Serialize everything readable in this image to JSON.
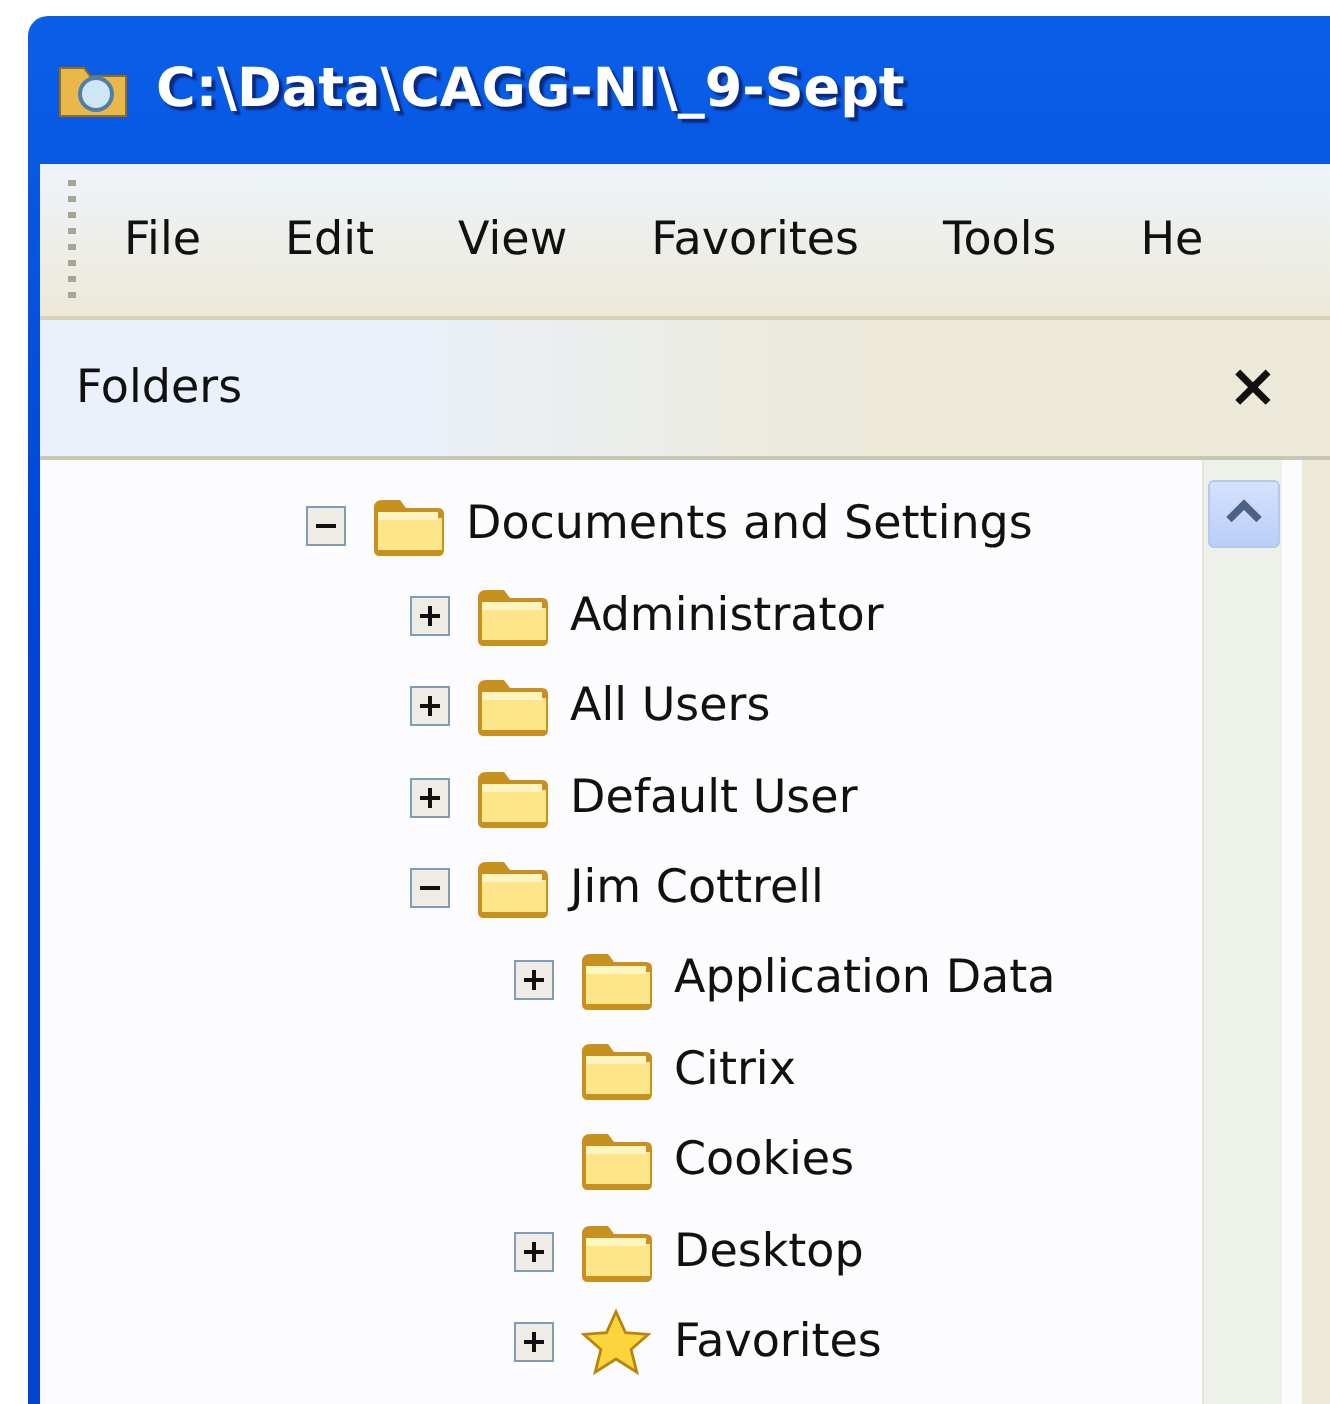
{
  "window": {
    "title": "C:\\Data\\CAGG-NI\\_9-Sept"
  },
  "menu": [
    "File",
    "Edit",
    "View",
    "Favorites",
    "Tools",
    "He"
  ],
  "folders_pane": {
    "title": "Folders",
    "close": "×"
  },
  "tree": [
    {
      "label": "Documents and Settings",
      "kind": "folder",
      "has_subfolders": true,
      "expanded": true,
      "children": [
        {
          "label": "Administrator",
          "kind": "folder",
          "has_subfolders": true,
          "expanded": false
        },
        {
          "label": "All Users",
          "kind": "folder",
          "has_subfolders": true,
          "expanded": false
        },
        {
          "label": "Default User",
          "kind": "folder",
          "has_subfolders": true,
          "expanded": false
        },
        {
          "label": "Jim Cottrell",
          "kind": "folder",
          "has_subfolders": true,
          "expanded": true,
          "children": [
            {
              "label": "Application Data",
              "kind": "folder",
              "has_subfolders": true,
              "expanded": false
            },
            {
              "label": "Citrix",
              "kind": "folder",
              "has_subfolders": false
            },
            {
              "label": "Cookies",
              "kind": "folder",
              "has_subfolders": false
            },
            {
              "label": "Desktop",
              "kind": "folder",
              "has_subfolders": true,
              "expanded": false
            },
            {
              "label": "Favorites",
              "kind": "favorites",
              "has_subfolders": true,
              "expanded": false
            }
          ]
        }
      ]
    }
  ]
}
